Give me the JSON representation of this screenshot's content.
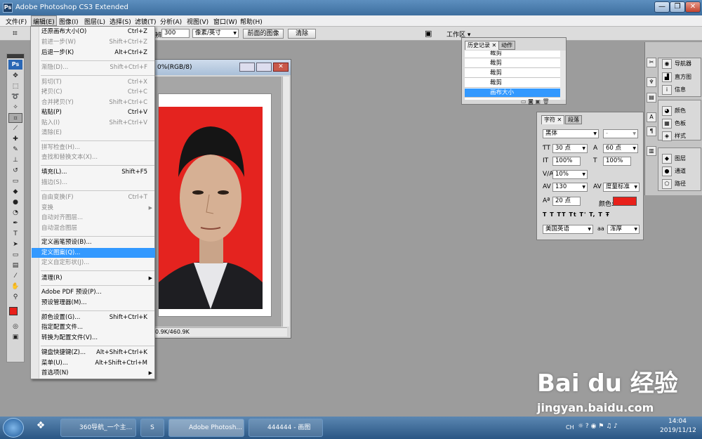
{
  "app": {
    "title": "Adobe Photoshop CS3 Extended",
    "ps_label": "Ps"
  },
  "window_buttons": {
    "minimize": "—",
    "restore": "❐",
    "close": "✕"
  },
  "menubar": [
    "文件(F)",
    "编辑(E)",
    "图像(I)",
    "图层(L)",
    "选择(S)",
    "滤镜(T)",
    "分析(A)",
    "视图(V)",
    "窗口(W)",
    "帮助(H)"
  ],
  "options": {
    "res_label": "分辨率:",
    "res_value": "300",
    "res_unit": "像素/英寸",
    "front_image": "前面的图像",
    "clear": "清除",
    "workspace": "工作区 ▾"
  },
  "doc": {
    "title": "0%(RGB/8)",
    "status": "0.9K/460.9K"
  },
  "edit_menu": [
    {
      "label": "还原画布大小(O)",
      "shortcut": "Ctrl+Z",
      "disabled": false
    },
    {
      "label": "前进一步(W)",
      "shortcut": "Shift+Ctrl+Z",
      "disabled": true
    },
    {
      "label": "后退一步(K)",
      "shortcut": "Alt+Ctrl+Z",
      "disabled": false
    },
    {
      "label": "渐隐(D)...",
      "shortcut": "Shift+Ctrl+F",
      "disabled": true
    },
    {
      "label": "剪切(T)",
      "shortcut": "Ctrl+X",
      "disabled": true
    },
    {
      "label": "拷贝(C)",
      "shortcut": "Ctrl+C",
      "disabled": true
    },
    {
      "label": "合并拷贝(Y)",
      "shortcut": "Shift+Ctrl+C",
      "disabled": true
    },
    {
      "label": "粘贴(P)",
      "shortcut": "Ctrl+V",
      "disabled": false
    },
    {
      "label": "贴入(I)",
      "shortcut": "Shift+Ctrl+V",
      "disabled": true
    },
    {
      "label": "清除(E)",
      "shortcut": "",
      "disabled": true
    },
    {
      "label": "拼写检查(H)...",
      "shortcut": "",
      "disabled": true
    },
    {
      "label": "查找和替换文本(X)...",
      "shortcut": "",
      "disabled": true
    },
    {
      "label": "填充(L)...",
      "shortcut": "Shift+F5",
      "disabled": false
    },
    {
      "label": "描边(S)...",
      "shortcut": "",
      "disabled": true
    },
    {
      "label": "自由变换(F)",
      "shortcut": "Ctrl+T",
      "disabled": true
    },
    {
      "label": "变换",
      "shortcut": "",
      "disabled": true
    },
    {
      "label": "自动对齐图层...",
      "shortcut": "",
      "disabled": true
    },
    {
      "label": "自动混合图层",
      "shortcut": "",
      "disabled": true
    },
    {
      "label": "定义画笔预设(B)...",
      "shortcut": "",
      "disabled": false
    },
    {
      "label": "定义图案(Q)...",
      "shortcut": "",
      "disabled": false
    },
    {
      "label": "定义自定形状(J)...",
      "shortcut": "",
      "disabled": true
    },
    {
      "label": "清理(R)",
      "shortcut": "",
      "disabled": false
    },
    {
      "label": "Adobe PDF 预设(P)...",
      "shortcut": "",
      "disabled": false
    },
    {
      "label": "预设管理器(M)...",
      "shortcut": "",
      "disabled": false
    },
    {
      "label": "颜色设置(G)...",
      "shortcut": "Shift+Ctrl+K",
      "disabled": false
    },
    {
      "label": "指定配置文件...",
      "shortcut": "",
      "disabled": false
    },
    {
      "label": "转换为配置文件(V)...",
      "shortcut": "",
      "disabled": false
    },
    {
      "label": "键盘快捷键(Z)...",
      "shortcut": "Alt+Shift+Ctrl+K",
      "disabled": false
    },
    {
      "label": "菜单(U)...",
      "shortcut": "Alt+Shift+Ctrl+M",
      "disabled": false
    },
    {
      "label": "首选项(N)",
      "shortcut": "",
      "disabled": false
    }
  ],
  "history": {
    "tab1": "历史记录",
    "tab2": "动作",
    "rows": [
      "裁剪",
      "裁剪",
      "裁剪",
      "裁剪",
      "画布大小"
    ]
  },
  "character": {
    "tab1": "字符",
    "tab2": "段落",
    "font": "黑体",
    "style": "-",
    "size": "30 点",
    "leading": "60 点",
    "vscale": "100%",
    "hscale": "100%",
    "baseline": "10%",
    "tracking": "130",
    "kerning": "度量标准",
    "shift": "20 点",
    "color_label": "颜色:",
    "language": "美国英语",
    "aa_label": "aa",
    "aa": "浑厚",
    "styles": [
      "T",
      "T",
      "TT",
      "Tt",
      "T'",
      "T,",
      "T",
      "Ŧ"
    ],
    "color": "#e8201a"
  },
  "dock": {
    "items": [
      "导航器",
      "直方图",
      "信息",
      "颜色",
      "色板",
      "样式",
      "图层",
      "通道",
      "路径"
    ]
  },
  "taskbar": {
    "items": [
      "360导航_一个主...",
      "Adobe Photosh...",
      "444444 - 画图"
    ],
    "time": "14:04",
    "date": "2019/11/12",
    "lang": "CH"
  },
  "watermark": {
    "line1": "Bai du 经验",
    "line2": "jingyan.baidu.com"
  }
}
